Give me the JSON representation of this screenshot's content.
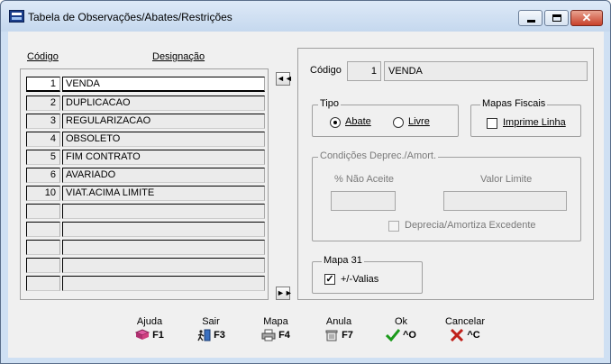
{
  "window": {
    "title": "Tabela de Observações/Abates/Restrições",
    "close_glyph": "✕"
  },
  "list": {
    "col_code": "Código",
    "col_name": "Designação",
    "rows": [
      {
        "code": "1",
        "name": "VENDA"
      },
      {
        "code": "2",
        "name": "DUPLICACAO"
      },
      {
        "code": "3",
        "name": "REGULARIZACAO"
      },
      {
        "code": "4",
        "name": "OBSOLETO"
      },
      {
        "code": "5",
        "name": "FIM CONTRATO"
      },
      {
        "code": "6",
        "name": "AVARIADO"
      },
      {
        "code": "10",
        "name": "VIAT.ACIMA LIMITE"
      },
      {
        "code": "",
        "name": ""
      },
      {
        "code": "",
        "name": ""
      },
      {
        "code": "",
        "name": ""
      },
      {
        "code": "",
        "name": ""
      },
      {
        "code": "",
        "name": ""
      }
    ],
    "nav_first": "◄◄",
    "nav_last": "►►"
  },
  "detail": {
    "code_label": "Código",
    "code_value": "1",
    "name_value": "VENDA",
    "tipo": {
      "title": "Tipo",
      "abate": "Abate",
      "livre": "Livre",
      "selected": "Abate"
    },
    "mapas": {
      "title": "Mapas Fiscais",
      "imprime_linha": "Imprime Linha",
      "checked": false
    },
    "condicoes": {
      "title": "Condições Deprec./Amort.",
      "nao_aceite_label": "% Não Aceite",
      "valor_limite_label": "Valor Limite",
      "nao_aceite_value": "",
      "valor_limite_value": "",
      "deprecia_label": "Deprecia/Amortiza Excedente"
    },
    "mapa31": {
      "title": "Mapa 31",
      "mais_valias": "+/-Valias",
      "checked": true,
      "check_glyph": "✓"
    }
  },
  "toolbar": [
    {
      "label": "Ajuda",
      "key": "F1",
      "icon": "help-book-icon"
    },
    {
      "label": "Sair",
      "key": "F3",
      "icon": "exit-door-icon"
    },
    {
      "label": "Mapa",
      "key": "F4",
      "icon": "printer-icon"
    },
    {
      "label": "Anula",
      "key": "F7",
      "icon": "delete-bin-icon"
    },
    {
      "label": "Ok",
      "key": "^O",
      "icon": "checkmark-icon"
    },
    {
      "label": "Cancelar",
      "key": "^C",
      "icon": "cancel-x-icon"
    }
  ],
  "colors": {
    "ok_green": "#1a9a1a",
    "cancel_red": "#c0201a",
    "titlebar": "#c5d8ee"
  }
}
